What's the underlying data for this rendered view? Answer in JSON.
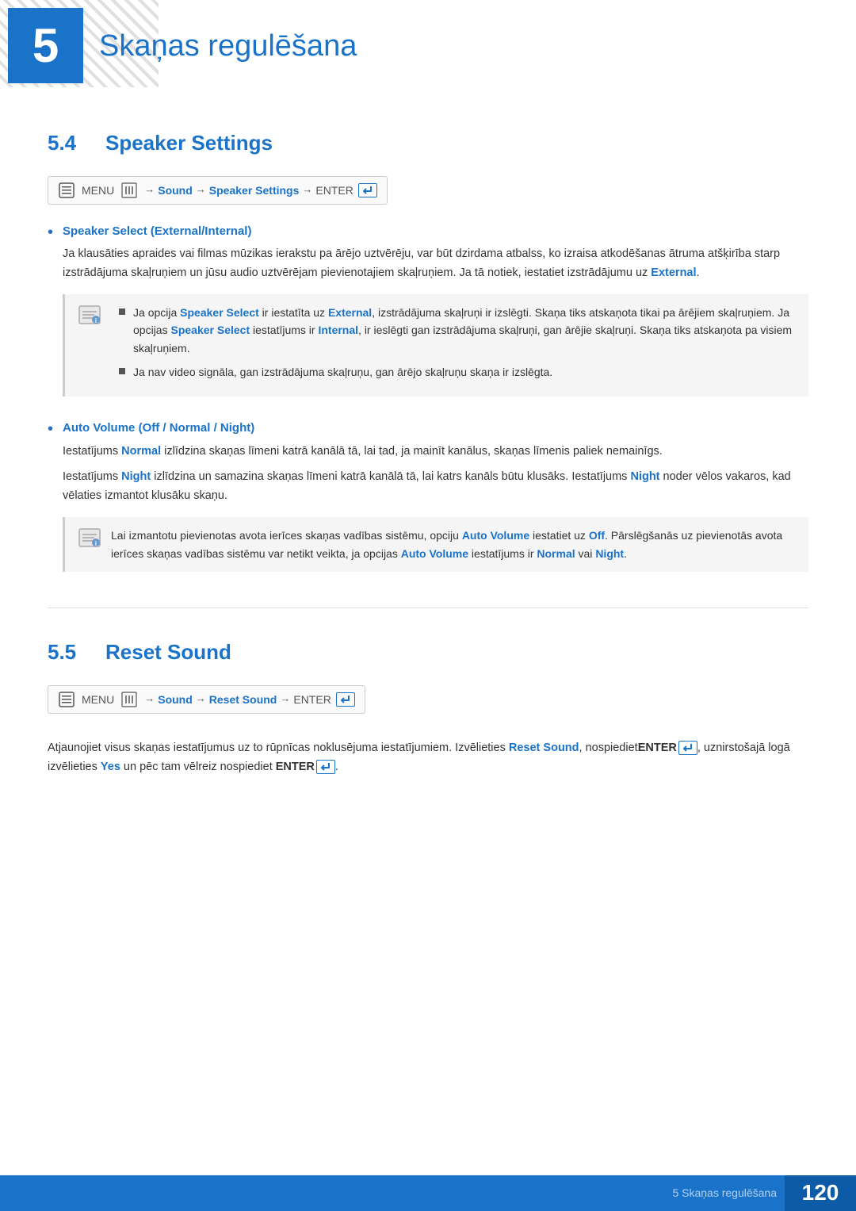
{
  "chapter": {
    "number": "5",
    "title": "Skaņas regulēšana"
  },
  "section_54": {
    "number": "5.4",
    "title": "Speaker Settings",
    "nav": {
      "menu_label": "MENU",
      "arrow1": "→",
      "sound": "Sound",
      "arrow2": "→",
      "speaker_settings": "Speaker Settings",
      "arrow3": "→",
      "enter": "ENTER"
    },
    "bullets": [
      {
        "title": "Speaker Select (External/Internal)",
        "body": "Ja klausāties apraides vai filmas mūzikas ierakstu pa ārējo uztvērēju, var būt dzirdama atbalss, ko izraisa atkodēšanas ātruma atšķirība starp izstrādājuma skaļruņiem un jūsu audio uztvērējam pievienotajiem skaļruņiem. Ja tā notiek, iestatiet izstrādājumu uz External.",
        "note": {
          "lines": [
            "Ja opcija Speaker Select ir iestatīta uz External, izstrādājuma skaļruņi ir izslēgti. Skaņa tiks atskaņota tikai pa ārējiem skaļruņiem. Ja opcijas Speaker Select iestatījums ir Internal, ir ieslēgti gan izstrādājuma skaļruņi, gan ārējie skaļruņi. Skaņa tiks atskaņota pa visiem skaļruņiem.",
            "Ja nav video signāla, gan izstrādājuma skaļruņu, gan ārējo skaļruņu skaņa ir izslēgta."
          ]
        }
      },
      {
        "title": "Auto Volume (Off / Normal / Night)",
        "body1": "Iestatījums Normal izlīdzina skaņas līmeni katrā kanālā tā, lai tad, ja mainīt kanālus, skaņas līmenis paliek nemainīgs.",
        "body2": "Iestatījums Night izlīdzina un samazina skaņas līmeni katrā kanālā tā, lai katrs kanāls būtu klusāks. Iestatījums Night noder vēlos vakaros, kad vēlaties izmantot klusāku skaņu.",
        "note2": "Lai izmantotu pievienotas avota ierīces skaņas vadības sistēmu, opciju Auto Volume iestatiet uz Off. Pārslēgšanās uz pievienotās avota ierīces skaņas vadības sistēmu var netikt veikta, ja opcijas Auto Volume iestatījums ir Normal vai Night."
      }
    ]
  },
  "section_55": {
    "number": "5.5",
    "title": "Reset Sound",
    "nav": {
      "menu_label": "MENU",
      "arrow1": "→",
      "sound": "Sound",
      "arrow2": "→",
      "reset_sound": "Reset Sound",
      "arrow3": "→",
      "enter": "ENTER"
    },
    "body": "Atjaunojiet visus skaņas iestatījumus uz to rūpnīcas noklusējuma iestatījumiem. Izvēlieties Reset Sound, nospiedietENTER[",
    "body2": "], uznirstošajā logā izvēlieties Yes un pēc tam vēlreiz nospiediet ENTER["
  },
  "footer": {
    "text": "5 Skaņas regulēšana",
    "page": "120"
  }
}
